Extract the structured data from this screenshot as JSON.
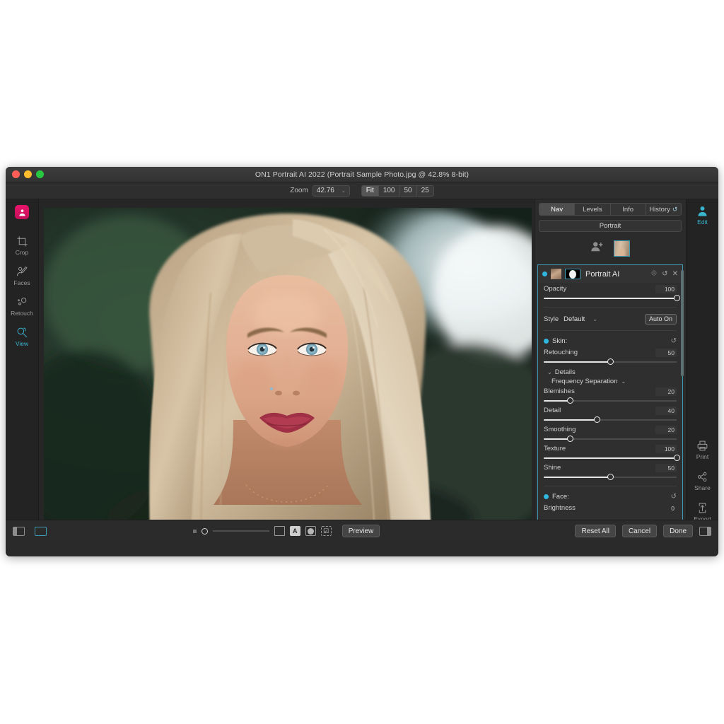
{
  "window": {
    "title": "ON1 Portrait AI 2022 (Portrait Sample Photo.jpg @ 42.8% 8-bit)"
  },
  "toolbar": {
    "zoom_label": "Zoom",
    "zoom_value": "42.76",
    "chevron": "⌄",
    "fit_buttons": [
      "Fit",
      "100",
      "50",
      "25"
    ]
  },
  "left_rail": {
    "tools": [
      {
        "label": "Crop",
        "icon": "crop-icon",
        "active": false
      },
      {
        "label": "Faces",
        "icon": "faces-icon",
        "active": false
      },
      {
        "label": "Retouch",
        "icon": "retouch-icon",
        "active": false
      },
      {
        "label": "View",
        "icon": "view-magnifier-hand-icon",
        "active": true
      }
    ]
  },
  "right_rail": {
    "top": [
      {
        "label": "Edit",
        "icon": "person-icon",
        "active": true
      }
    ],
    "bottom": [
      {
        "label": "Print",
        "icon": "printer-icon"
      },
      {
        "label": "Share",
        "icon": "share-nodes-icon"
      },
      {
        "label": "Export",
        "icon": "export-up-arrow-icon"
      }
    ]
  },
  "panel": {
    "tabs": [
      {
        "label": "Nav",
        "active": true
      },
      {
        "label": "Levels",
        "active": false
      },
      {
        "label": "Info",
        "active": false
      },
      {
        "label": "History",
        "active": false,
        "icon": "↺"
      }
    ],
    "preset_bar": "Portrait",
    "face_strip": {
      "add_face_icon": "add-person-icon",
      "thumb_label": "face-thumbnail"
    },
    "layer": {
      "name": "Portrait AI",
      "gear_icon": "gear-icon",
      "reset_icon": "↺",
      "close_icon": "✕"
    },
    "opacity": {
      "label": "Opacity",
      "value": "100",
      "percent": 100
    },
    "style": {
      "label": "Style",
      "value": "Default",
      "chevron": "⌄",
      "auto_button": "Auto On"
    },
    "skin": {
      "label": "Skin:",
      "reset_icon": "↺",
      "retouching": {
        "label": "Retouching",
        "value": "50",
        "percent": 50
      },
      "details_label": "Details",
      "details_chevron": "⌄",
      "frequency_separation": {
        "label": "Frequency Separation",
        "chevron": "⌄"
      },
      "sliders": [
        {
          "label": "Blemishes",
          "value": "20",
          "percent": 20
        },
        {
          "label": "Detail",
          "value": "40",
          "percent": 40
        },
        {
          "label": "Smoothing",
          "value": "20",
          "percent": 20
        },
        {
          "label": "Texture",
          "value": "100",
          "percent": 100
        },
        {
          "label": "Shine",
          "value": "50",
          "percent": 50
        }
      ]
    },
    "face": {
      "label": "Face:",
      "reset_icon": "↺",
      "brightness": {
        "label": "Brightness",
        "value": "0",
        "percent": 0
      }
    }
  },
  "bottom_bar": {
    "left_icons": [
      "panel-toggle-left-icon",
      "panel-toggle-canvas-icon"
    ],
    "center": {
      "mini_square_icon": "soft-proof-square-icon",
      "slider_percent": 3,
      "icons": [
        {
          "name": "square-outline-icon",
          "glyph": ""
        },
        {
          "name": "letter-a-icon",
          "glyph": "A"
        },
        {
          "name": "filled-circle-icon",
          "glyph": ""
        },
        {
          "name": "checkbox-dashed-icon",
          "glyph": "☑"
        }
      ],
      "preview_button": "Preview"
    },
    "right": {
      "buttons": [
        "Reset All",
        "Cancel",
        "Done"
      ],
      "panel_icon": "panel-toggle-right-icon"
    }
  },
  "colors": {
    "accent_teal": "#3f9bb3",
    "accent_blue": "#2fb7dd",
    "app_pink": "#e8146b",
    "window_bg": "#2b2b2b"
  }
}
